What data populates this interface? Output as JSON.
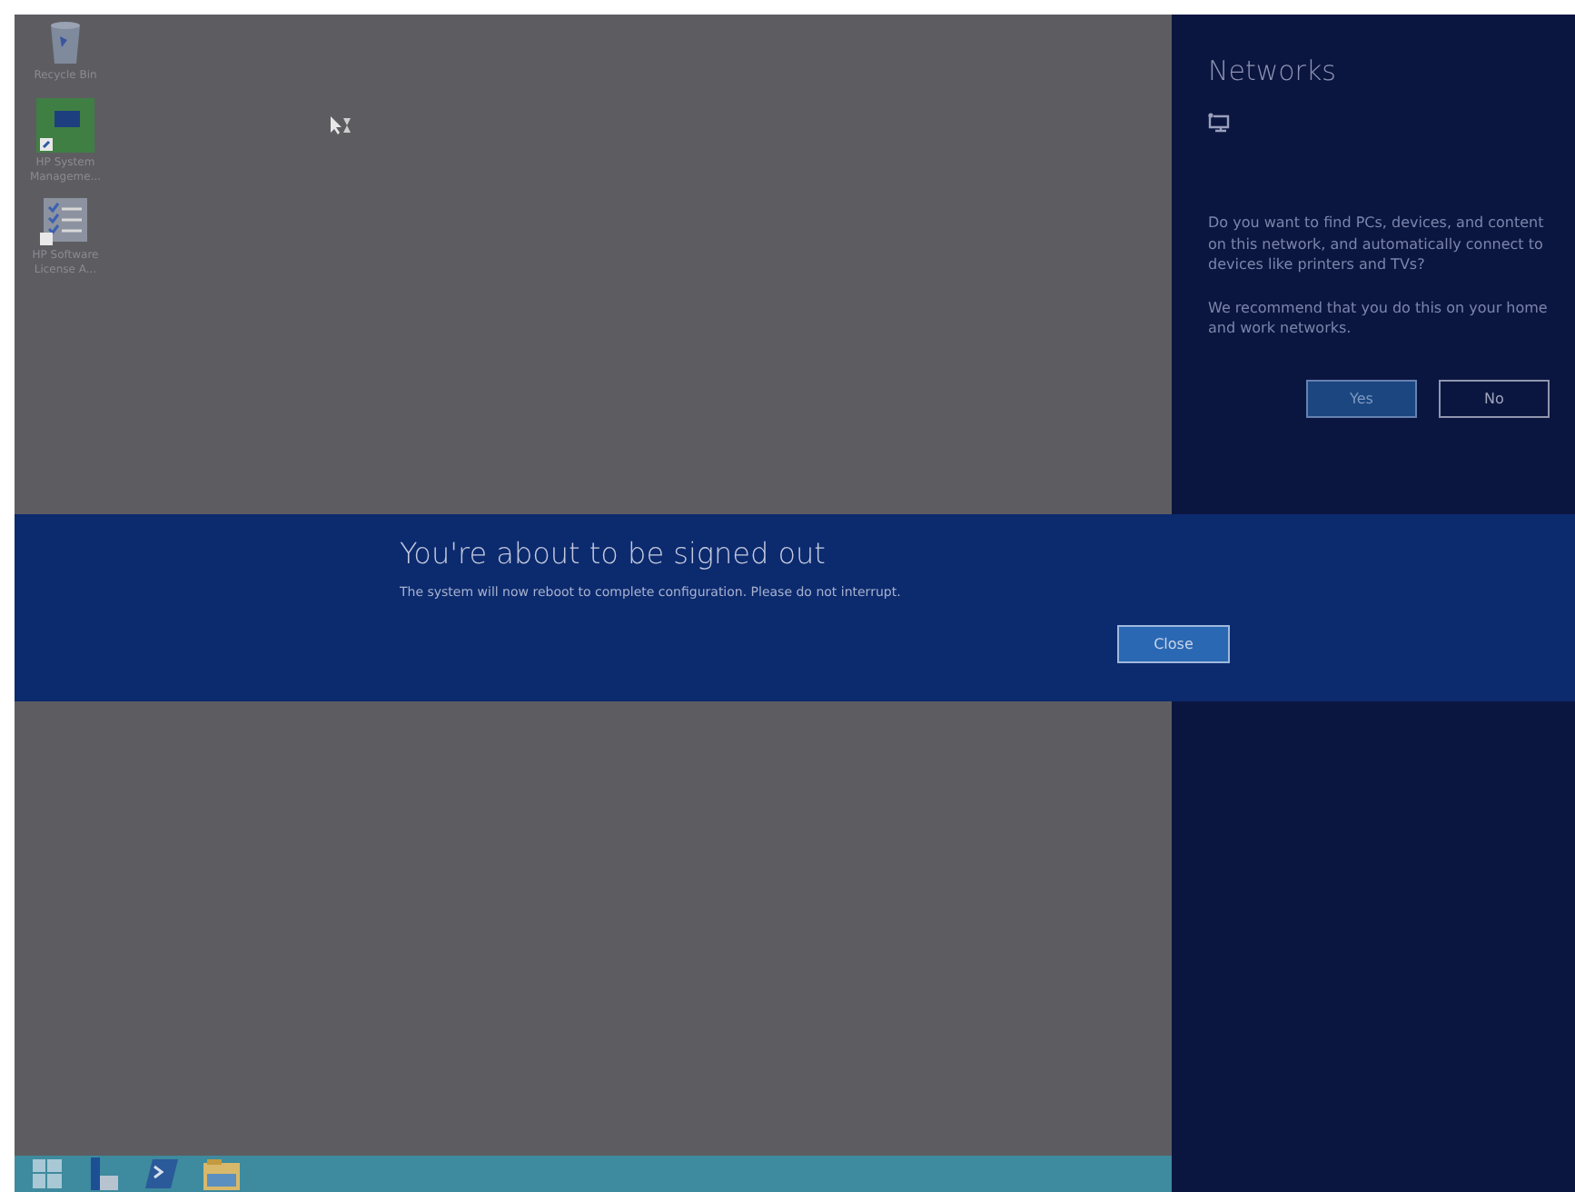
{
  "desktop": {
    "icons": [
      {
        "kind": "bin",
        "label": "Recycle Bin"
      },
      {
        "kind": "monitor",
        "label": "HP System Manageme..."
      },
      {
        "kind": "checklist",
        "label": "HP Software License A..."
      }
    ]
  },
  "taskbar": {
    "items": [
      {
        "kind": "start"
      },
      {
        "kind": "server"
      },
      {
        "kind": "shell"
      },
      {
        "kind": "folder"
      }
    ]
  },
  "networks_panel": {
    "title": "Networks",
    "paragraphs": [
      "Do you want to find PCs, devices, and content on this network, and automatically connect to devices like printers and TVs?",
      "We recommend that you do this on your home and work networks."
    ],
    "buttons": [
      {
        "label": "Yes",
        "selected": true
      },
      {
        "label": "No",
        "selected": false
      }
    ]
  },
  "sign_out_dialog": {
    "title": "You're about to be signed out",
    "message": "The system will now reboot to complete configuration. Please do not interrupt.",
    "button": "Close"
  }
}
